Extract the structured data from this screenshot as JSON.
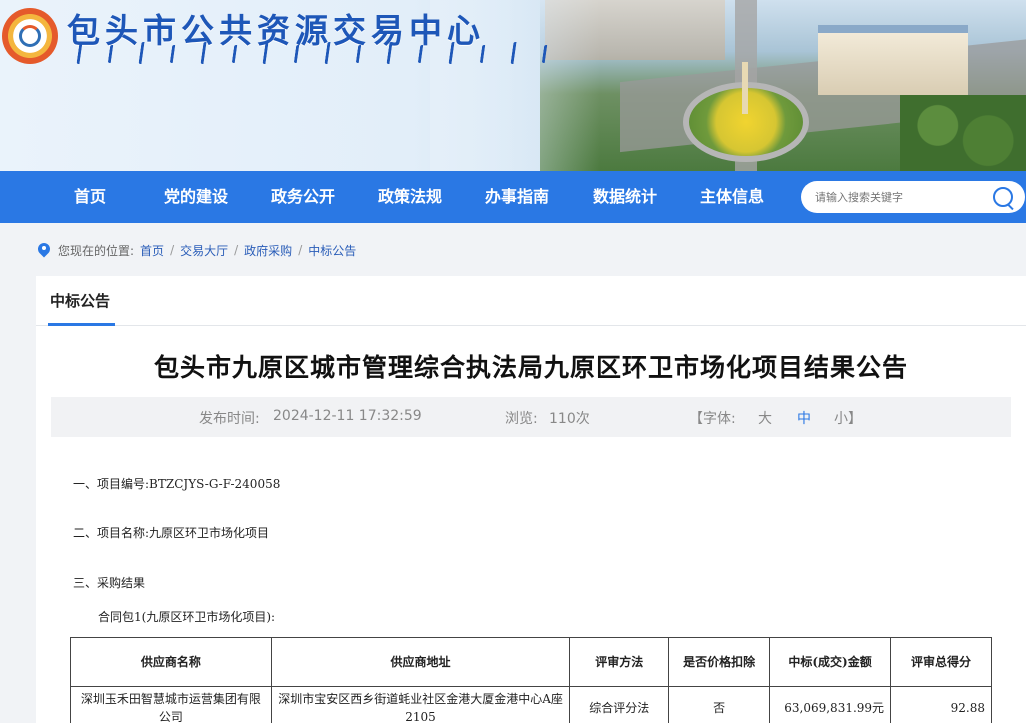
{
  "header": {
    "site_title": "包头市公共资源交易中心"
  },
  "nav": {
    "items": [
      "首页",
      "党的建设",
      "政务公开",
      "政策法规",
      "办事指南",
      "数据统计",
      "主体信息"
    ],
    "search_placeholder": "请输入搜索关键字"
  },
  "breadcrumb": {
    "prefix": "您现在的位置:",
    "items": [
      "首页",
      "交易大厅",
      "政府采购",
      "中标公告"
    ]
  },
  "section": {
    "tab_label": "中标公告"
  },
  "article": {
    "title": "包头市九原区城市管理综合执法局九原区环卫市场化项目结果公告",
    "publish_label": "发布时间:",
    "publish_time": "2024-12-11 17:32:59",
    "views_label": "浏览:",
    "views": "110次",
    "font_label": "【字体:",
    "font_large": "大",
    "font_medium": "中",
    "font_small": "小】",
    "lines": [
      "一、项目编号:BTZCJYS-G-F-240058",
      "二、项目名称:九原区环卫市场化项目",
      "三、采购结果",
      "合同包1(九原区环卫市场化项目):"
    ]
  },
  "table": {
    "headers": [
      "供应商名称",
      "供应商地址",
      "评审方法",
      "是否价格扣除",
      "中标(成交)金额",
      "评审总得分"
    ],
    "rows": [
      [
        "深圳玉禾田智慧城市运营集团有限公司",
        "深圳市宝安区西乡街道蚝业社区金港大厦金港中心A座2105",
        "综合评分法",
        "否",
        "63,069,831.99元",
        "92.88"
      ]
    ]
  },
  "colors": {
    "nav_bg": "#2a78e4",
    "title_blue": "#1e57b8",
    "accent": "#2a78e4"
  }
}
